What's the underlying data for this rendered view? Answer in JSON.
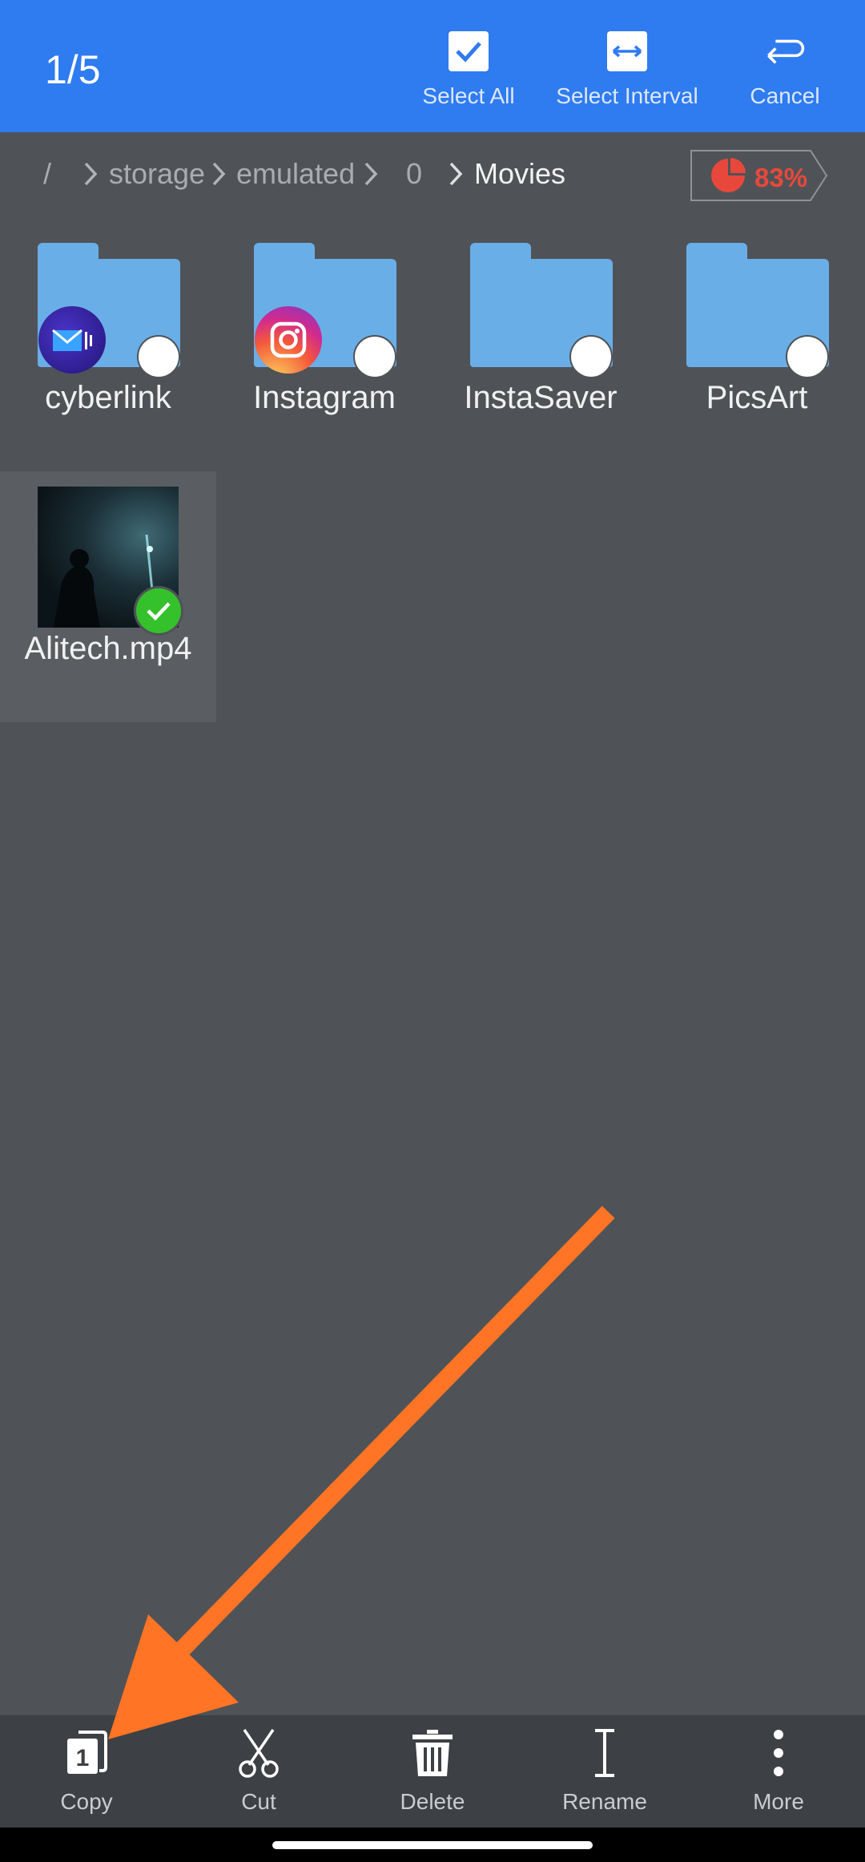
{
  "selection": {
    "count": "1/5"
  },
  "top_actions": {
    "select_all": "Select All",
    "select_interval": "Select Interval",
    "cancel": "Cancel"
  },
  "breadcrumb": {
    "root": "/",
    "items": [
      "storage",
      "emulated",
      "0",
      "Movies"
    ]
  },
  "storage": {
    "percent": "83%",
    "used_fraction": 0.83,
    "color": "#e8483b"
  },
  "folders": [
    {
      "name": "cyberlink",
      "badge": "cyberlink-app-icon"
    },
    {
      "name": "Instagram",
      "badge": "instagram-app-icon"
    },
    {
      "name": "InstaSaver",
      "badge": ""
    },
    {
      "name": "PicsArt",
      "badge": ""
    }
  ],
  "files": [
    {
      "name": "Alitech.mp4",
      "selected": true
    }
  ],
  "bottom_actions": {
    "copy": "Copy",
    "cut": "Cut",
    "delete": "Delete",
    "rename": "Rename",
    "more": "More"
  },
  "copy_icon_number": "1",
  "colors": {
    "accent": "#2f7bf0",
    "background": "#4f5357",
    "folder": "#6aaee8",
    "annotation_arrow": "#ff7425",
    "check": "#35c12b"
  }
}
